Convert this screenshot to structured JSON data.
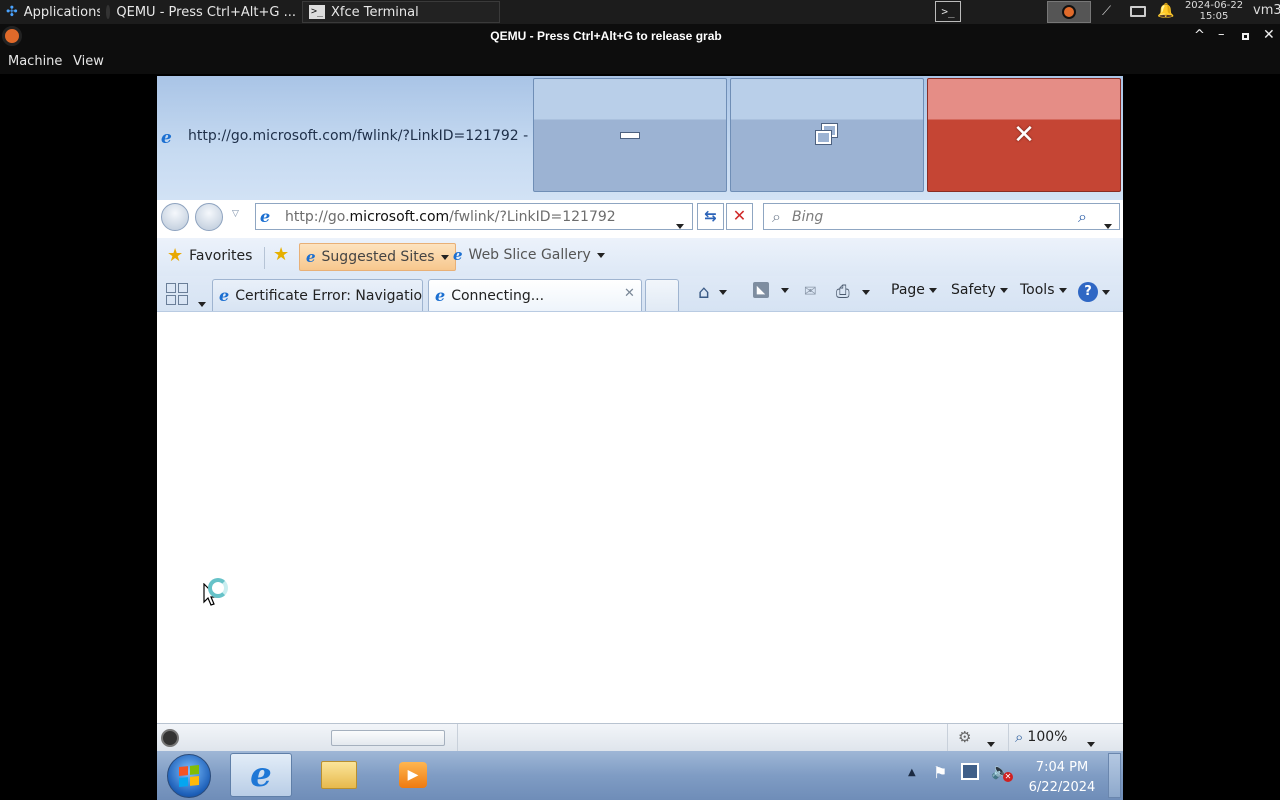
{
  "host_panel": {
    "applications_label": "Applications",
    "tasks": [
      {
        "label": "QEMU - Press Ctrl+Alt+G ..."
      },
      {
        "label": "Xfce Terminal"
      }
    ],
    "clock_date": "2024-06-22",
    "clock_time": "15:05",
    "user": "vm3"
  },
  "qemu": {
    "title": "QEMU - Press Ctrl+Alt+G to release grab",
    "menu": [
      "Machine",
      "View"
    ]
  },
  "ie": {
    "window_title": "http://go.microsoft.com/fwlink/?LinkID=121792 - ...",
    "address_prefix": "http://go.",
    "address_domain": "microsoft.com",
    "address_path": "/fwlink/?LinkID=121792",
    "search_placeholder": "Bing",
    "favorites": {
      "favorites_label": "Favorites",
      "suggested_sites": "Suggested Sites",
      "web_slice_gallery": "Web Slice Gallery"
    },
    "tabs": [
      {
        "label": "Certificate Error: Navigatio..."
      },
      {
        "label": "Connecting..."
      }
    ],
    "commands": {
      "page": "Page",
      "safety": "Safety",
      "tools": "Tools"
    },
    "status": {
      "zoom": "100%"
    }
  },
  "win_taskbar": {
    "time": "7:04 PM",
    "date": "6/22/2024"
  }
}
